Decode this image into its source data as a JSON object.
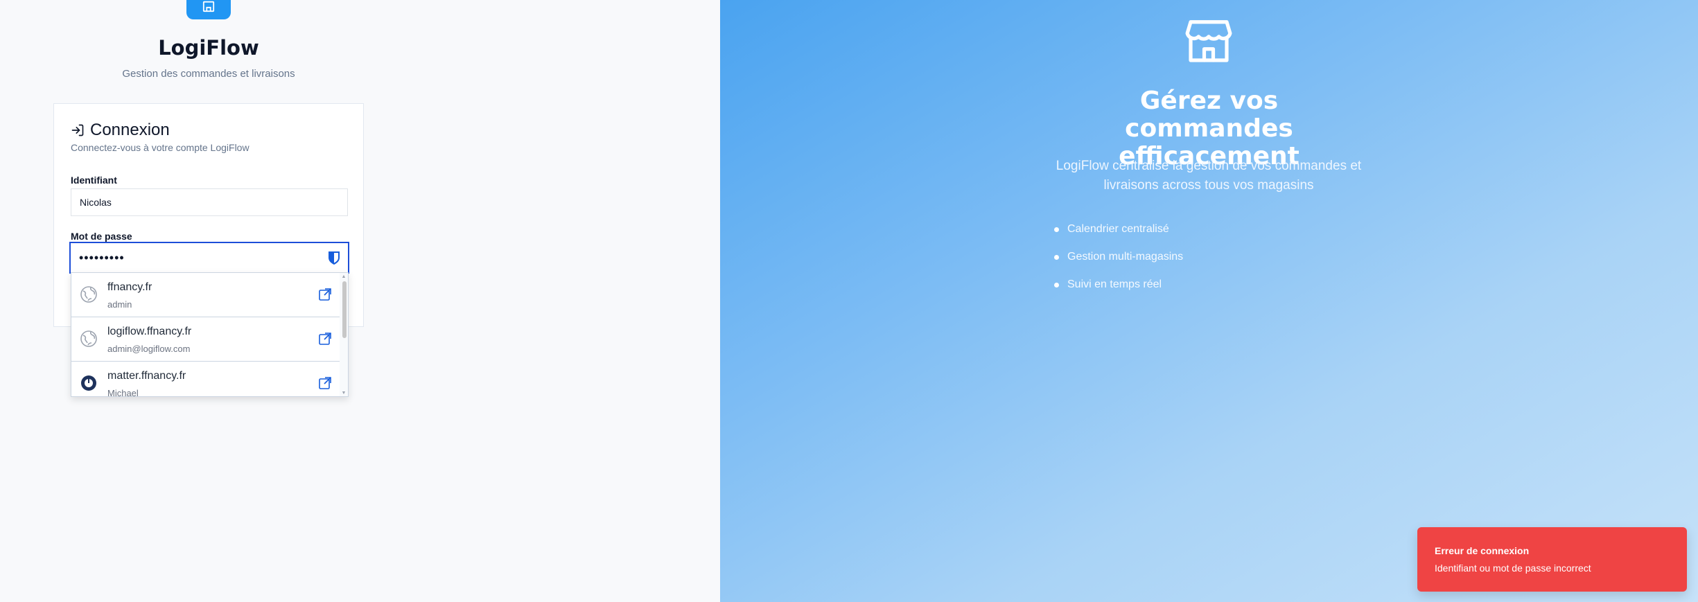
{
  "brand": {
    "name": "LogiFlow",
    "tagline": "Gestion des commandes et livraisons"
  },
  "login": {
    "title": "Connexion",
    "description": "Connectez-vous à votre compte LogiFlow",
    "username_label": "Identifiant",
    "username_value": "Nicolas",
    "password_label": "Mot de passe",
    "password_value": "•••••••••"
  },
  "autofill": {
    "items": [
      {
        "site": "ffnancy.fr",
        "user": "admin",
        "icon": "globe-icon"
      },
      {
        "site": "logiflow.ffnancy.fr",
        "user": "admin@logiflow.com",
        "icon": "globe-icon"
      },
      {
        "site": "matter.ffnancy.fr",
        "user": "Michael",
        "icon": "mattermost-icon"
      }
    ]
  },
  "hero": {
    "title": "Gérez vos commandes efficacement",
    "subtitle": "LogiFlow centralise la gestion de vos commandes et livraisons across tous vos magasins",
    "features": [
      "Calendrier centralisé",
      "Gestion multi-magasins",
      "Suivi en temps réel"
    ]
  },
  "toast": {
    "title": "Erreur de connexion",
    "message": "Identifiant ou mot de passe incorrect"
  },
  "colors": {
    "accent": "#2196f3",
    "focus": "#1d4ed8",
    "error": "#ef4444"
  }
}
